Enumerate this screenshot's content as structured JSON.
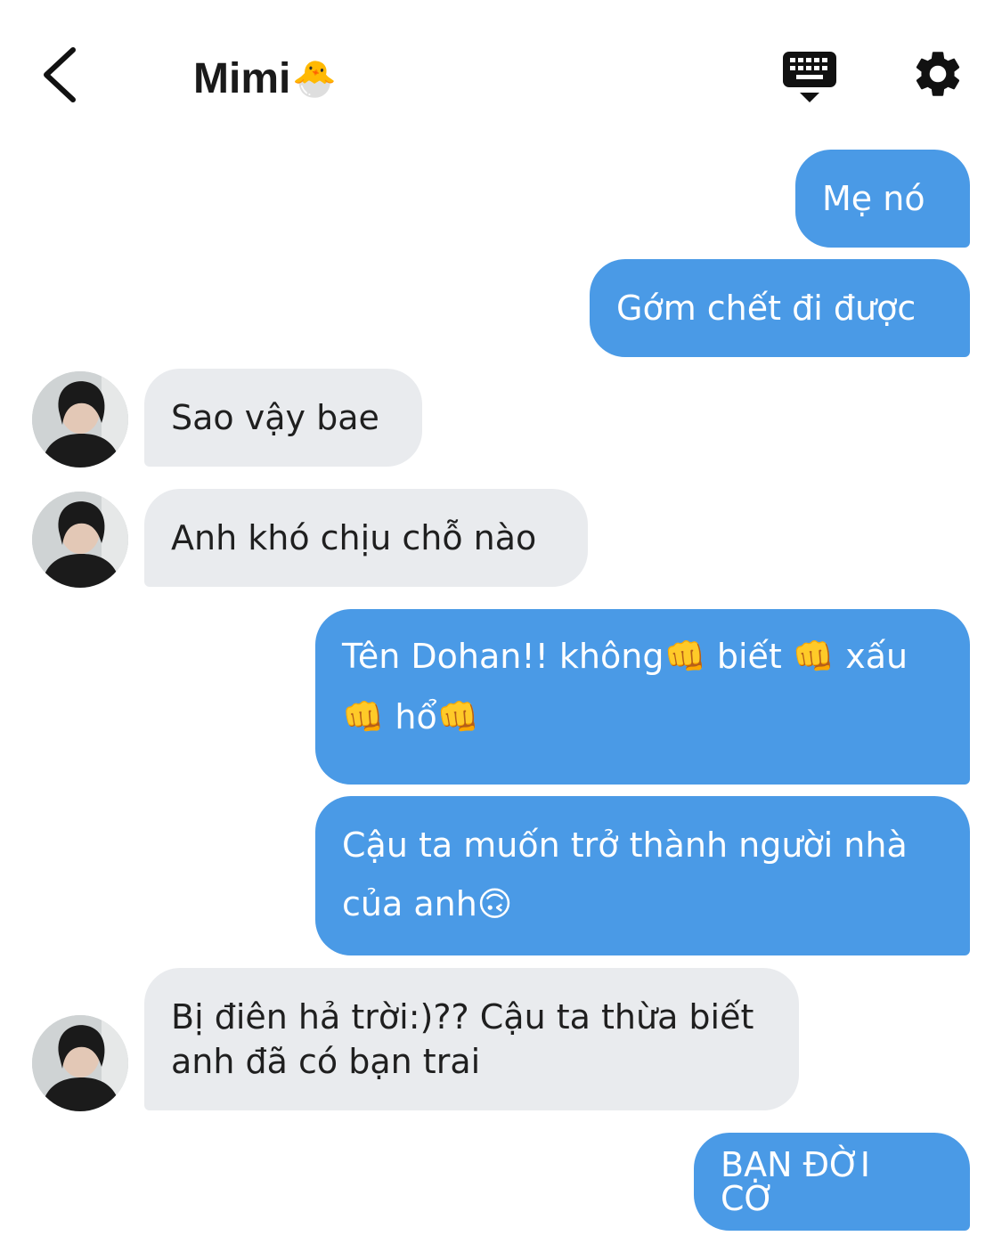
{
  "header": {
    "back_icon": "chevron-left-icon",
    "contact_name": "Mimi",
    "contact_emoji": "🐣",
    "keyboard_icon": "keyboard-hide-icon",
    "settings_icon": "gear-icon"
  },
  "colors": {
    "outgoing_bubble": "#4a9ae6",
    "incoming_bubble": "#e9ebee",
    "outgoing_text": "#ffffff",
    "incoming_text": "#1f1f1f"
  },
  "messages": [
    {
      "direction": "out",
      "text": "Mẹ nó"
    },
    {
      "direction": "out",
      "text": "Gớm chết đi được"
    },
    {
      "direction": "in",
      "text": "Sao vậy bae"
    },
    {
      "direction": "in",
      "text": "Anh khó chịu chỗ nào"
    },
    {
      "direction": "out",
      "line1": "Tên Dohan!! không👊 biết 👊 xấu",
      "line2": "👊 hổ👊"
    },
    {
      "direction": "out",
      "line1": "Cậu ta muốn trở thành người nhà",
      "line2": "của anh🙃"
    },
    {
      "direction": "in",
      "line1": "Bị điên hả trời:)?? Cậu ta thừa biết",
      "line2": "anh đã có bạn trai"
    },
    {
      "direction": "out",
      "text": "BẠN ĐỜI CƠ"
    }
  ]
}
